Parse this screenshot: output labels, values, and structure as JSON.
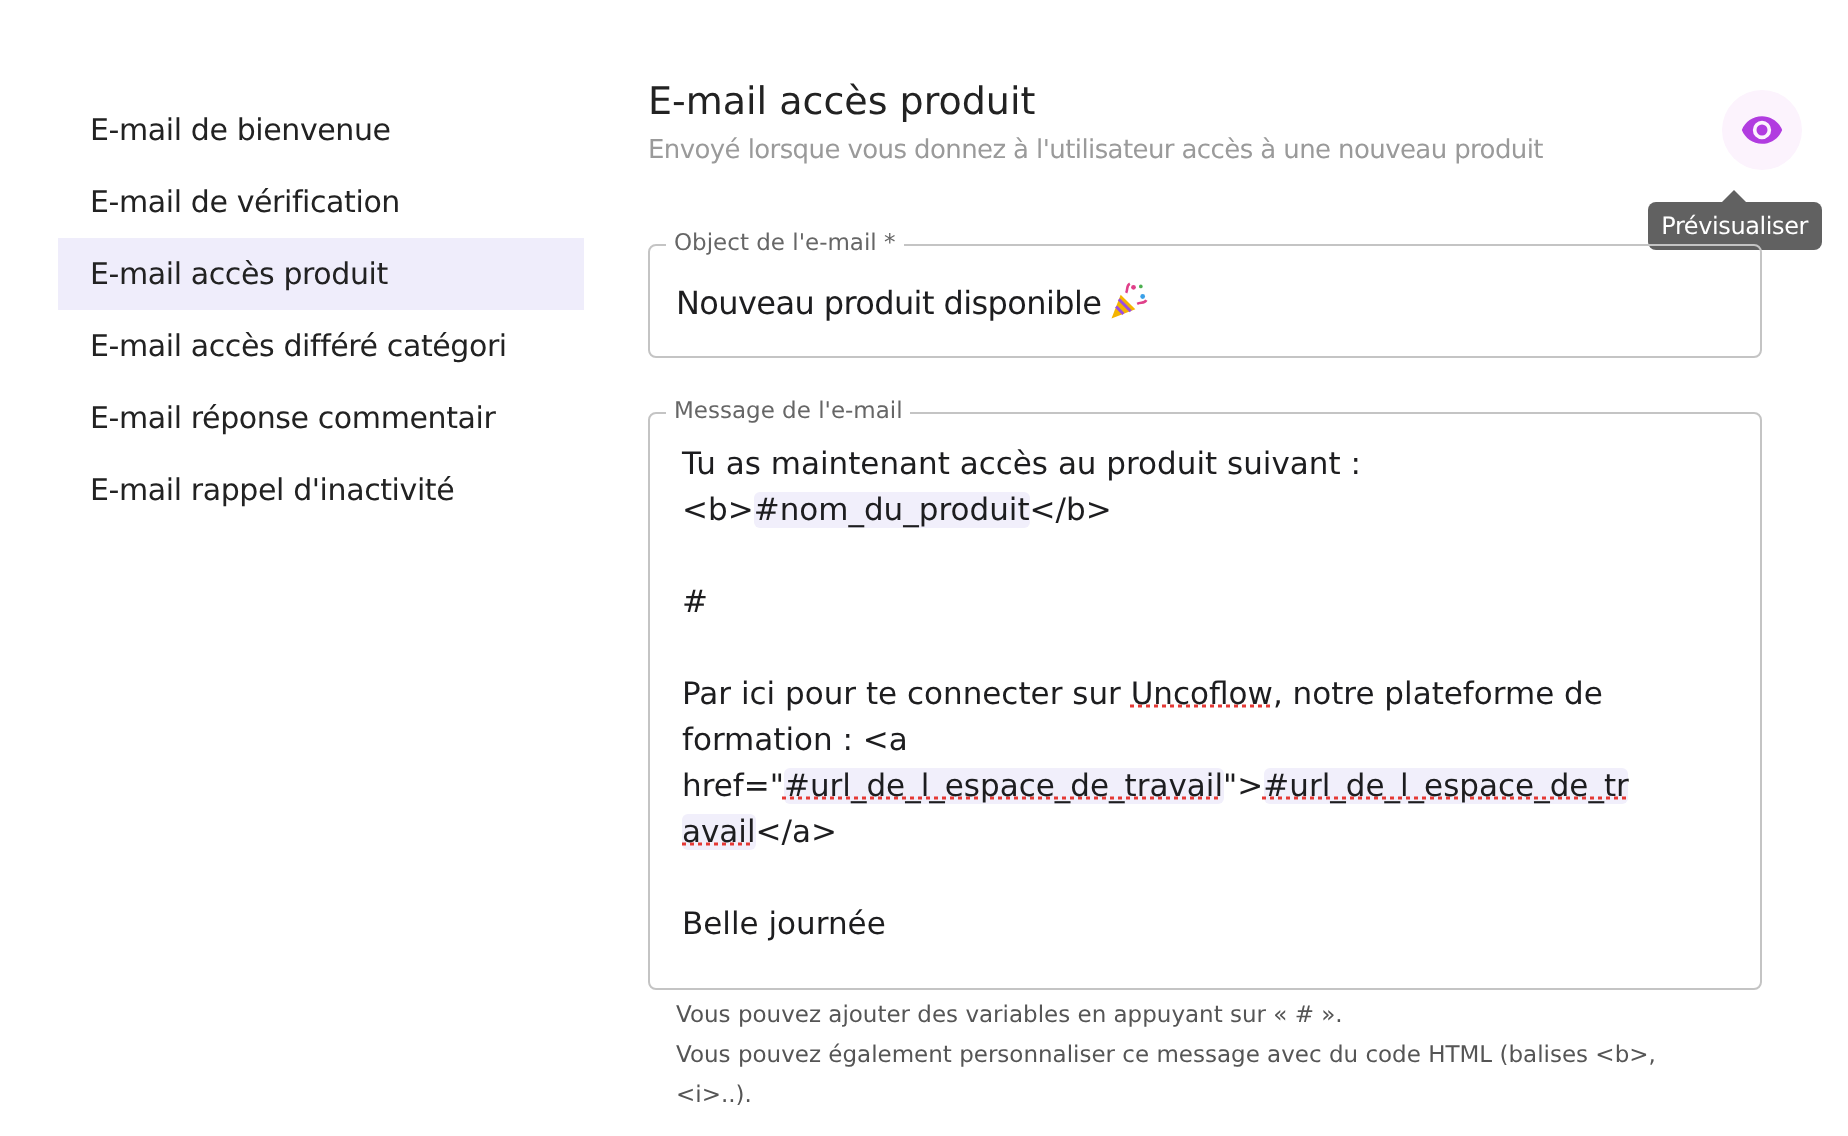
{
  "sidebar": {
    "items": [
      {
        "label": "E-mail de bienvenue",
        "selected": false
      },
      {
        "label": "E-mail de vérification",
        "selected": false
      },
      {
        "label": "E-mail accès produit",
        "selected": true
      },
      {
        "label": "E-mail accès différé catégori",
        "selected": false
      },
      {
        "label": "E-mail réponse commentair",
        "selected": false
      },
      {
        "label": "E-mail rappel d'inactivité",
        "selected": false
      }
    ]
  },
  "header": {
    "title": "E-mail accès produit",
    "subtitle": "Envoyé lorsque vous donnez à l'utilisateur accès à une nouveau produit",
    "preview_tooltip": "Prévisualiser"
  },
  "subject": {
    "label": "Object de l'e-mail *",
    "value": "Nouveau produit disponible"
  },
  "message": {
    "label": "Message de l'e-mail",
    "lines": [
      {
        "kind": "text",
        "segments": [
          {
            "text": "Tu as maintenant accès au produit suivant :"
          }
        ]
      },
      {
        "kind": "text",
        "segments": [
          {
            "text": "<b>"
          },
          {
            "text": "#nom_du_produit",
            "variable": true
          },
          {
            "text": "</b>"
          }
        ]
      },
      {
        "kind": "blank"
      },
      {
        "kind": "text",
        "segments": [
          {
            "text": "#"
          }
        ]
      },
      {
        "kind": "blank"
      },
      {
        "kind": "text",
        "segments": [
          {
            "text": "Par ici pour te connecter sur "
          },
          {
            "text": "Uncoflow",
            "misspelled": true
          },
          {
            "text": ", notre plateforme de"
          }
        ]
      },
      {
        "kind": "text",
        "segments": [
          {
            "text": "formation : <a"
          }
        ]
      },
      {
        "kind": "text",
        "segments": [
          {
            "text": "href=\""
          },
          {
            "text": "#url_de_l_espace_de_travail",
            "variable": true,
            "misspelled": true
          },
          {
            "text": "\">"
          },
          {
            "text": "#url_de_l_espace_de_tr",
            "variable": true,
            "misspelled": true
          }
        ]
      },
      {
        "kind": "text",
        "segments": [
          {
            "text": "avail",
            "variable": true,
            "misspelled": true
          },
          {
            "text": "</a>"
          }
        ]
      },
      {
        "kind": "blank"
      },
      {
        "kind": "text",
        "segments": [
          {
            "text": "Belle journée"
          }
        ]
      }
    ]
  },
  "help": [
    "Vous pouvez ajouter des variables en appuyant sur « # ».",
    "Vous pouvez également personnaliser ce message avec du code HTML (balises <b>, <i>..)."
  ]
}
